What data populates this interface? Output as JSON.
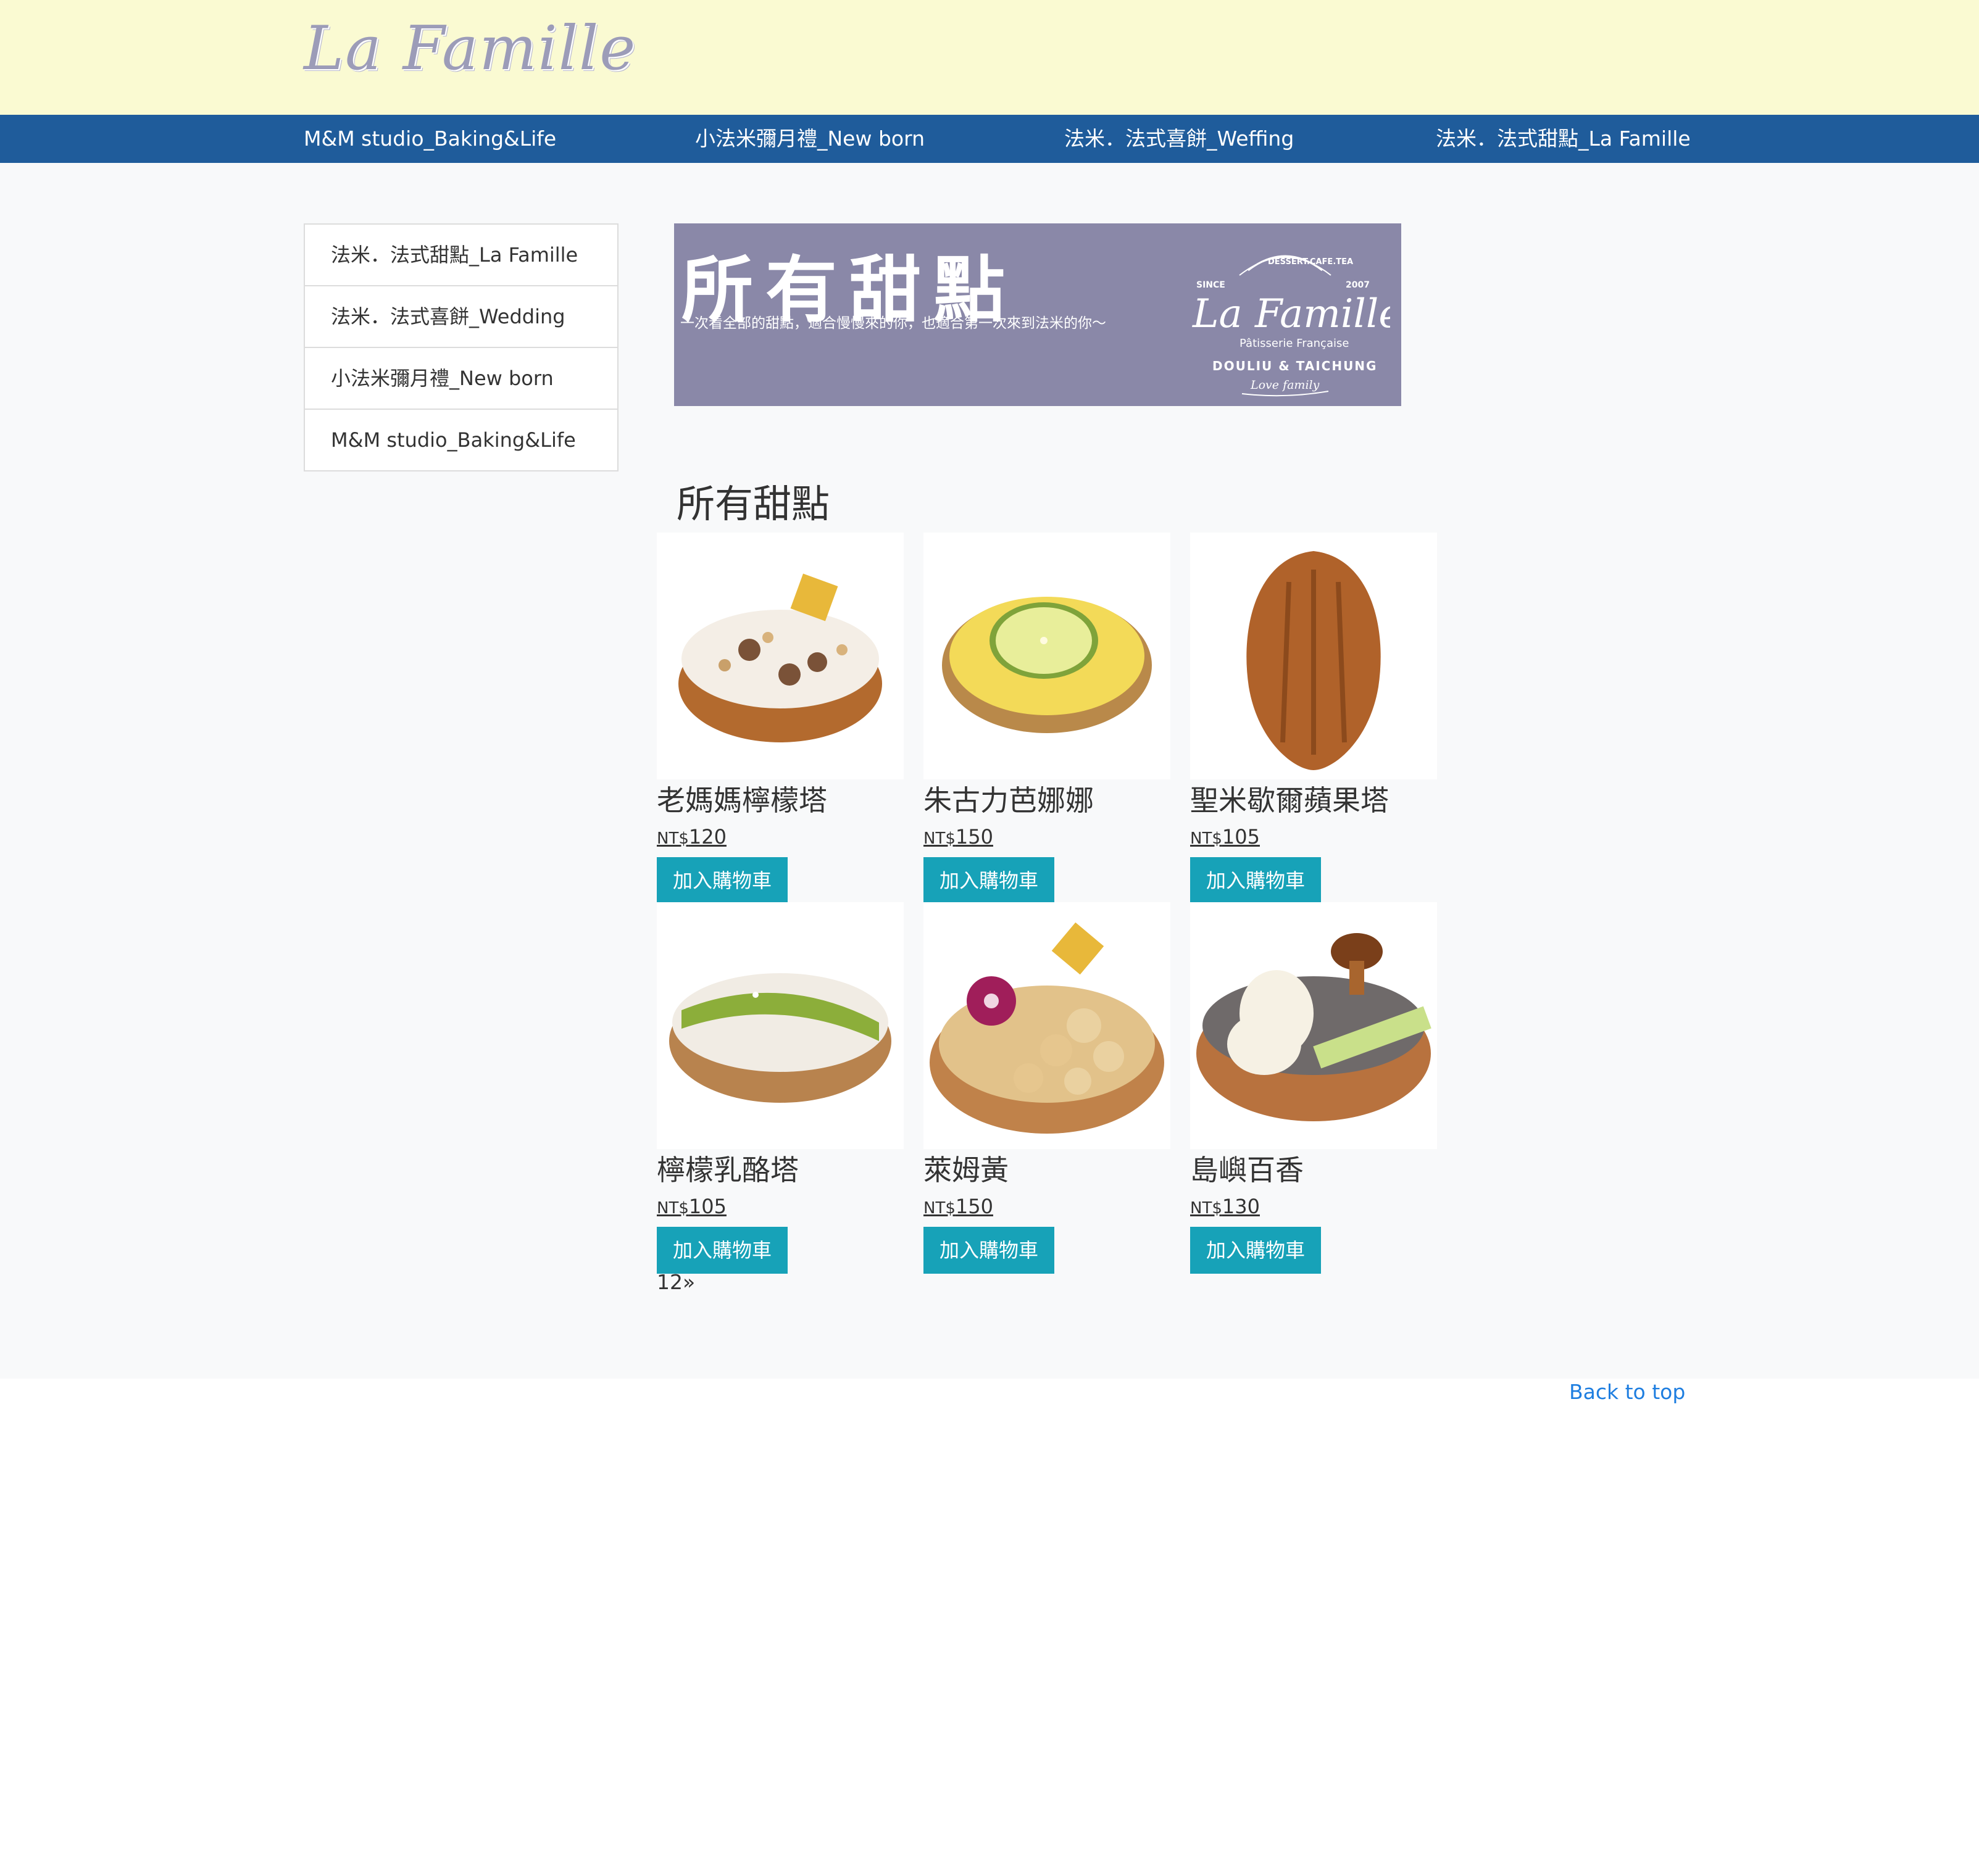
{
  "header": {
    "logo_text": "La Famille"
  },
  "nav": {
    "items": [
      "M&M studio_Baking&Life",
      "小法米彌月禮_New born",
      "法米．法式喜餅_Weffing",
      "法米．法式甜點_La Famille"
    ]
  },
  "sidebar": {
    "items": [
      "法米．法式甜點_La Famille",
      "法米．法式喜餅_Wedding",
      "小法米彌月禮_New born",
      "M&M studio_Baking&Life"
    ]
  },
  "banner": {
    "title": "所有甜點",
    "subtitle": "一次看全部的甜點，適合慢慢來的你，也適合第一次來到法米的你～",
    "logo": {
      "since": "SINCE",
      "year": "2007",
      "arc": "DESSERT.CAFE.TEA",
      "name": "La Famille",
      "tagline": "Pâtisserie Française",
      "locations": "DOULIU & TAICHUNG",
      "motto": "Love family"
    }
  },
  "section": {
    "title": "所有甜點"
  },
  "currency": "NT$",
  "cart_button_label": "加入購物車",
  "products": [
    {
      "name": "老媽媽檸檬塔",
      "price": "120",
      "icon": "cream-cookie-tart"
    },
    {
      "name": "朱古力芭娜娜",
      "price": "150",
      "icon": "lemon-slice-tart"
    },
    {
      "name": "聖米歇爾蘋果塔",
      "price": "105",
      "icon": "madeleine"
    },
    {
      "name": "檸檬乳酪塔",
      "price": "105",
      "icon": "matcha-tart"
    },
    {
      "name": "萊姆黃",
      "price": "150",
      "icon": "flower-crumble-tart"
    },
    {
      "name": "島嶼百香",
      "price": "130",
      "icon": "mushroom-cream-tart"
    }
  ],
  "pagination": {
    "pages": [
      "1",
      "2"
    ],
    "next": "»"
  },
  "footer": {
    "back_to_top": "Back to top"
  }
}
